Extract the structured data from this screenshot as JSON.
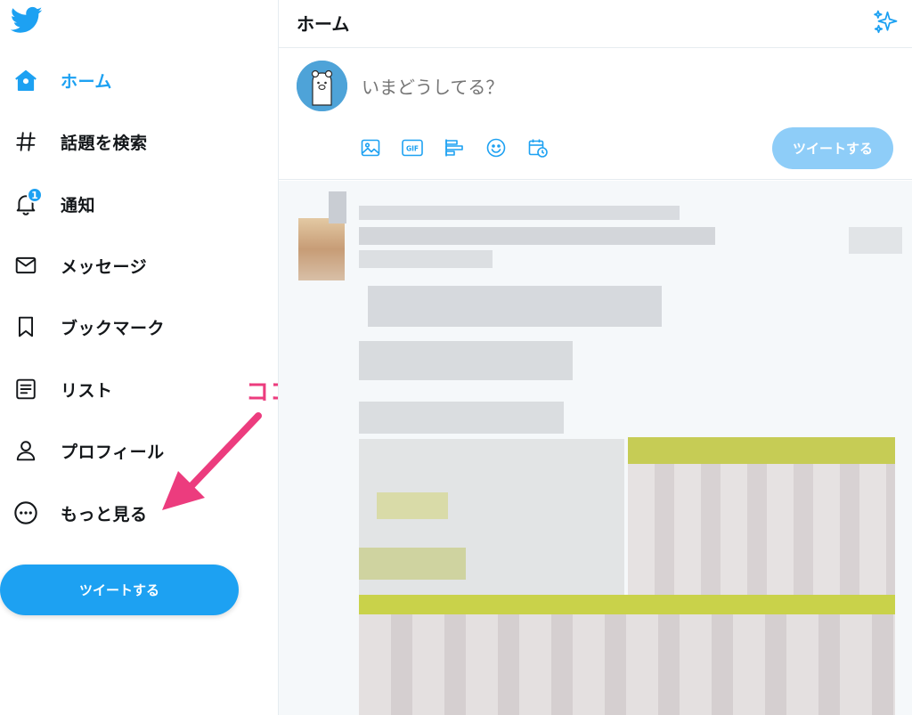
{
  "sidebar": {
    "items": [
      {
        "label": "ホーム",
        "icon": "home-icon",
        "active": true
      },
      {
        "label": "話題を検索",
        "icon": "hashtag-icon"
      },
      {
        "label": "通知",
        "icon": "bell-icon",
        "badge": "1"
      },
      {
        "label": "メッセージ",
        "icon": "envelope-icon"
      },
      {
        "label": "ブックマーク",
        "icon": "bookmark-icon"
      },
      {
        "label": "リスト",
        "icon": "list-icon"
      },
      {
        "label": "プロフィール",
        "icon": "person-icon"
      },
      {
        "label": "もっと見る",
        "icon": "more-circle-icon"
      }
    ],
    "tweet_button": "ツイートする"
  },
  "annotation": {
    "text": "ココ",
    "color": "#ec3c7e"
  },
  "header": {
    "title": "ホーム",
    "icon": "sparkle-icon"
  },
  "composer": {
    "placeholder": "いまどうしてる？",
    "tools": [
      "image-icon",
      "gif-icon",
      "poll-icon",
      "emoji-icon",
      "schedule-icon"
    ],
    "gif_text": "GIF",
    "tweet_button": "ツイートする"
  },
  "colors": {
    "accent": "#1da1f2",
    "accent_disabled": "#8ecdf8",
    "text": "#14171a",
    "muted": "#657786",
    "border": "#e6ecf0"
  }
}
